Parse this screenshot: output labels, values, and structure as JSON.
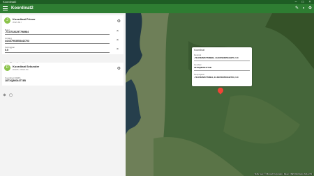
{
  "window": {
    "title": "Koordinat2",
    "controls": [
      "–",
      "□",
      "×"
    ]
  },
  "appbar": {
    "title": "Koordinat2",
    "icons": [
      "edit-icon",
      "brightness-icon",
      "settings-icon"
    ]
  },
  "primary": {
    "avatar_letter": "J",
    "name": "Koordinat Primer",
    "subtitle": "WGS 84 /",
    "settings_icon": "⚙",
    "fields": [
      {
        "label": "Bujur",
        "value": "-73.87326257798984"
      },
      {
        "label": "Lintang",
        "value": "44.637903553442703"
      },
      {
        "label": "Ketinggian",
        "value": "0.0"
      }
    ],
    "clear_icon": "×"
  },
  "primary_actions": [
    "⊕",
    "▢",
    "◎",
    "✉"
  ],
  "secondary": {
    "avatar_letter": "D",
    "name": "Koordinat Sekunder",
    "subtitle": "DGRS / WGS 84",
    "settings_icon": "⚙",
    "fields": [
      {
        "label": "Koordinat DGRS",
        "value": "18TXQ86044774B"
      }
    ]
  },
  "secondary_actions": [
    "⊕",
    "▢"
  ],
  "popup": {
    "title": "Koordinat",
    "rows": [
      {
        "label": "Desimal",
        "value": "-73.87326257798984, 44.63790355344270, 0.0"
      },
      {
        "label": "Geodesi",
        "value": "18TXQ86044774B"
      },
      {
        "label": "Geoprojeksi",
        "value": "-73.8732625779894, 44.637903553442703, 0.0"
      }
    ]
  },
  "attribution": "Buffer map | © Microsoft Corporation, Maxar, CNES Distribution Airbus DS"
}
